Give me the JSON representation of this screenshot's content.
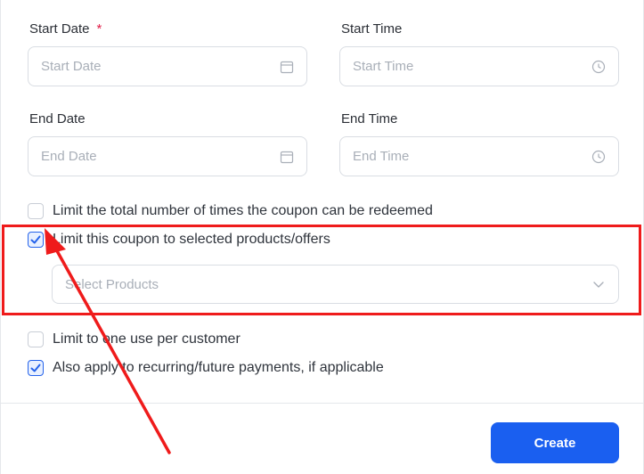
{
  "form": {
    "start_date": {
      "label": "Start Date",
      "required_mark": "*",
      "placeholder": "Start Date",
      "icon": "calendar-icon"
    },
    "start_time": {
      "label": "Start Time",
      "placeholder": "Start Time",
      "icon": "clock-icon"
    },
    "end_date": {
      "label": "End Date",
      "placeholder": "End Date",
      "icon": "calendar-icon"
    },
    "end_time": {
      "label": "End Time",
      "placeholder": "End Time",
      "icon": "clock-icon"
    },
    "options": [
      {
        "label": "Limit the total number of times the coupon can be redeemed",
        "checked": false
      },
      {
        "label": "Limit this coupon to selected products/offers",
        "checked": true
      },
      {
        "label": "Limit to one use per customer",
        "checked": false
      },
      {
        "label": "Also apply to recurring/future payments, if applicable",
        "checked": true
      }
    ],
    "products_select": {
      "placeholder": "Select Products",
      "icon": "chevron-down-icon"
    },
    "create_label": "Create"
  },
  "colors": {
    "accent": "#1a5ff0",
    "annotation": "#ef1b1b",
    "checkbox_checked": "#2563eb"
  }
}
